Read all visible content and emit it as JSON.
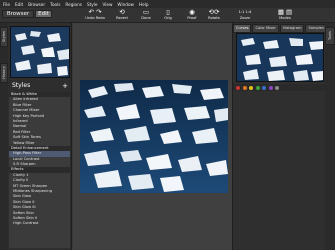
{
  "menubar": [
    "File",
    "Edit",
    "Browser",
    "Tools",
    "Regions",
    "Style",
    "View",
    "Window",
    "Help"
  ],
  "modes": {
    "browser": "Browser",
    "edit": "Edit"
  },
  "toolbar": {
    "undo_redo": "Undo Redo",
    "revert": "Revert",
    "done": "Done",
    "orig": "Orig",
    "proof": "Proof",
    "rotate": "Rotate",
    "zoom": "Zoom",
    "zoom_values": "1:1   1:4",
    "modes": "Modes"
  },
  "left_tabs": [
    "Styles",
    "History"
  ],
  "right_tabs": [
    "Tools",
    "Curves",
    "Color Mixer",
    "Histogram",
    "Samples"
  ],
  "styles": {
    "title": "Styles",
    "add": "+",
    "items": [
      {
        "label": "Black & White",
        "type": "group"
      },
      {
        "label": "Alien Infrared",
        "type": "item"
      },
      {
        "label": "Blue Filter",
        "type": "item"
      },
      {
        "label": "Channel Mixer",
        "type": "item"
      },
      {
        "label": "High Key Portrait",
        "type": "item"
      },
      {
        "label": "Infrared",
        "type": "item"
      },
      {
        "label": "Normal",
        "type": "item"
      },
      {
        "label": "Red Filter",
        "type": "item"
      },
      {
        "label": "Soft Skin Tones",
        "type": "item"
      },
      {
        "label": "Yellow Filter",
        "type": "item"
      },
      {
        "label": "Detail Enhancement",
        "type": "group"
      },
      {
        "label": "High-Pass Filter",
        "type": "item"
      },
      {
        "label": "Local Contrast",
        "type": "item"
      },
      {
        "label": "S.R Sharpen",
        "type": "item"
      },
      {
        "label": "Effects",
        "type": "group"
      },
      {
        "label": "Clarity 1",
        "type": "item"
      },
      {
        "label": "Clarity II",
        "type": "item"
      },
      {
        "label": "MT Green Sharpen",
        "type": "item"
      },
      {
        "label": "Midtones Sharpening",
        "type": "item"
      },
      {
        "label": "Skin Glow",
        "type": "item"
      },
      {
        "label": "Skin Glow II",
        "type": "item"
      },
      {
        "label": "Skin Glow III",
        "type": "item"
      },
      {
        "label": "Soften Skin",
        "type": "item"
      },
      {
        "label": "Soften Skin II",
        "type": "item"
      },
      {
        "label": "High Contrast",
        "type": "item"
      }
    ]
  },
  "colors": {
    "accent": "#4e5a72",
    "swatches": [
      "#cc3333",
      "#e07a1f",
      "#e0c21f",
      "#3aa53a",
      "#3a6fd0",
      "#8a45c0",
      "#888888"
    ]
  },
  "icons": [
    "undo-icon",
    "redo-icon",
    "revert-icon",
    "done-icon",
    "orig-icon",
    "proof-icon",
    "rotate-icon",
    "zoom-icon",
    "modes-icon"
  ]
}
